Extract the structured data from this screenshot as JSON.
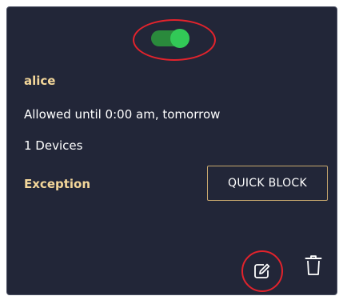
{
  "card": {
    "toggle_state": "on",
    "user_name": "alice",
    "allowed_text": "Allowed until 0:00 am, tomorrow",
    "devices_text": "1 Devices",
    "exception_label": "Exception",
    "quick_block_label": "QUICK BLOCK",
    "icons": {
      "edit": "edit-icon",
      "delete": "trash-icon"
    }
  },
  "colors": {
    "card_background": "#222638",
    "accent_text": "#f4d79a",
    "toggle_on": "#32c957",
    "highlight_ring": "#e2232c",
    "button_border": "#c8a86e"
  }
}
